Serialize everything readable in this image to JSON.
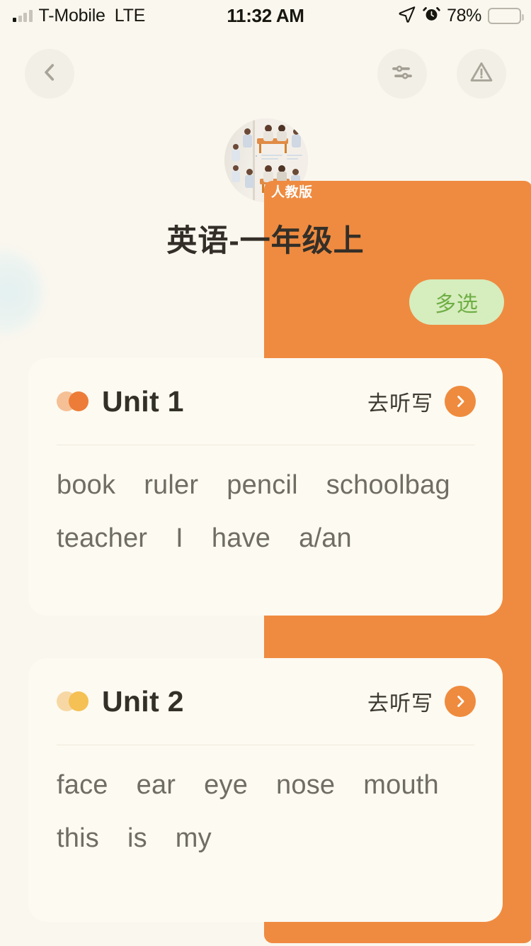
{
  "status_bar": {
    "carrier": "T-Mobile",
    "network": "LTE",
    "time": "11:32 AM",
    "battery_percent": "78%",
    "icons": [
      "signal-bars-icon",
      "location-arrow-icon",
      "alarm-clock-icon",
      "battery-icon"
    ]
  },
  "nav": {
    "back_icon": "chevron-left-icon",
    "filter_icon": "sliders-settings-icon",
    "warning_icon": "warning-triangle-icon"
  },
  "book": {
    "title": "英语-一年级上",
    "edition_badge": "人教版",
    "cover_icon": "book-cover-thumbnail"
  },
  "toolbar": {
    "multiselect_label": "多选",
    "multiselect_bg": "#d6edbe",
    "multiselect_text_color": "#6fae45"
  },
  "units": [
    {
      "name": "Unit 1",
      "action_label": "去听写",
      "action_icon": "chevron-right-icon",
      "dot_colors": [
        "#f5c096",
        "#ec7c38"
      ],
      "word_rows": [
        [
          "book",
          "ruler",
          "pencil",
          "schoolbag"
        ],
        [
          "teacher",
          "I",
          "have",
          "a/an"
        ]
      ]
    },
    {
      "name": "Unit 2",
      "action_label": "去听写",
      "action_icon": "chevron-right-icon",
      "dot_colors": [
        "#f7d8a4",
        "#f5c054"
      ],
      "word_rows": [
        [
          "face",
          "ear",
          "eye",
          "nose",
          "mouth"
        ],
        [
          "this",
          "is",
          "my"
        ]
      ]
    }
  ],
  "theme": {
    "page_bg": "#faf7ef",
    "card_bg": "#fdfaf1",
    "accent_orange": "#ef8b3e",
    "text_dark": "#333028",
    "text_word": "#6f6d64"
  }
}
